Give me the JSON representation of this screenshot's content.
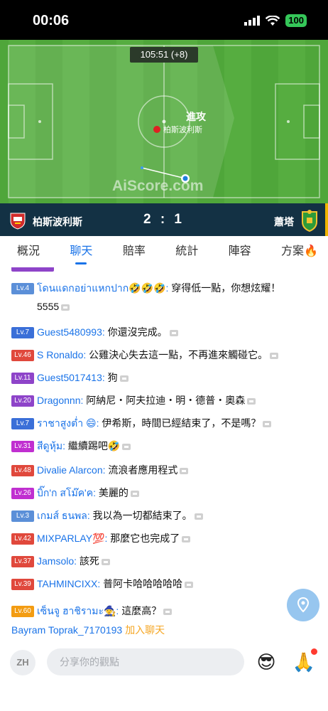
{
  "status_bar": {
    "time": "00:06",
    "battery": "100"
  },
  "pitch": {
    "clock": "105:51 (+8)",
    "attack_label": "進攻",
    "attack_team": "柏斯波利斯",
    "watermark": "AiScore.com"
  },
  "scoreboard": {
    "home": "柏斯波利斯",
    "score": "2 : 1",
    "away": "蕭塔"
  },
  "tabs": [
    {
      "label": "概況",
      "active": false
    },
    {
      "label": "聊天",
      "active": true
    },
    {
      "label": "賠率",
      "active": false
    },
    {
      "label": "統計",
      "active": false
    },
    {
      "label": "陣容",
      "active": false
    },
    {
      "label": "方案",
      "active": false
    }
  ],
  "chat": [
    {
      "level": "Lv.4",
      "level_color": "#5b8fd8",
      "user": "โดนแดกอย่าแหกปาก🤣🤣🤣",
      "text": "穿得低一點，你想炫耀！",
      "text2": "5555"
    },
    {
      "level": "Lv.7",
      "level_color": "#3a6fd8",
      "user": "Guest5480993",
      "text": "你還沒完成。"
    },
    {
      "level": "Lv.46",
      "level_color": "#e0483c",
      "user": "S Ronaldo",
      "text": "公雞決心失去這一點，不再進來觸碰它。"
    },
    {
      "level": "Lv.11",
      "level_color": "#8e44c9",
      "user": "Guest5017413",
      "text": "狗"
    },
    {
      "level": "Lv.20",
      "level_color": "#8e44c9",
      "user": "Dragonnn",
      "text": "阿納尼・阿夫拉迪・明・德普・奧森"
    },
    {
      "level": "Lv.7",
      "level_color": "#3a6fd8",
      "user": "ราชาสูงต่ำ 😄",
      "text": "伊希斯，時間已經結束了，不是嗎？"
    },
    {
      "level": "Lv.31",
      "level_color": "#c02fd0",
      "user": "สีดูหุ้ม",
      "text": "繼續踢吧🤣"
    },
    {
      "level": "Lv.48",
      "level_color": "#e0483c",
      "user": "Divalie Alarcon",
      "text": "流浪者應用程式"
    },
    {
      "level": "Lv.26",
      "level_color": "#c02fd0",
      "user": "บิ๊ก'ก สโม๊ค'ค",
      "text": "美麗的"
    },
    {
      "level": "Lv.3",
      "level_color": "#5b8fd8",
      "user": "เกมส์ ธนพล",
      "text": "我以為一切都結束了。"
    },
    {
      "level": "Lv.42",
      "level_color": "#e0483c",
      "user": "MIXPARLAY💯",
      "text": "那麼它也完成了"
    },
    {
      "level": "Lv.37",
      "level_color": "#e0483c",
      "user": "Jamsolo",
      "text": "該死"
    },
    {
      "level": "Lv.39",
      "level_color": "#e0483c",
      "user": "TAHMINCIXX",
      "text": "普阿卡哈哈哈哈哈"
    },
    {
      "level": "Lv.60",
      "level_color": "#f39c12",
      "user": "เซ็นจู ฮาชิรามะ🧙",
      "text": "這麼高？"
    }
  ],
  "join": {
    "user": "Bayram Toprak_7170193",
    "text": "加入聊天"
  },
  "input": {
    "lang": "ZH",
    "placeholder": "分享你的觀點",
    "emoji": "😎",
    "gift": "🙏"
  }
}
